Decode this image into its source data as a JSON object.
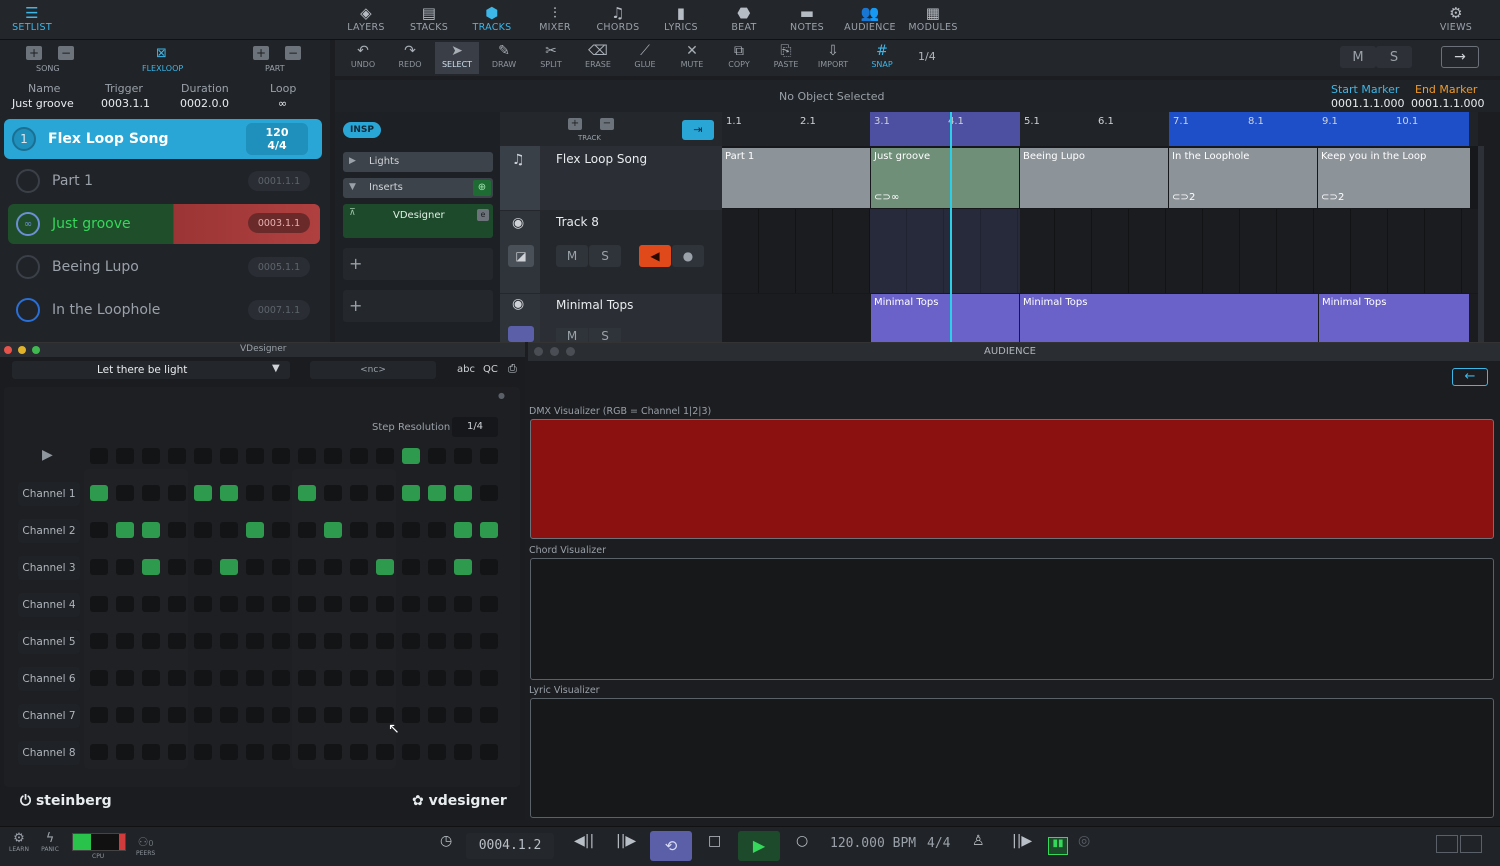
{
  "topnav": {
    "setlist": "SETLIST",
    "items": [
      "LAYERS",
      "STACKS",
      "TRACKS",
      "MIXER",
      "CHORDS",
      "LYRICS",
      "BEAT",
      "NOTES",
      "AUDIENCE",
      "MODULES"
    ],
    "views": "VIEWS"
  },
  "tools": {
    "items": [
      "UNDO",
      "REDO",
      "SELECT",
      "DRAW",
      "SPLIT",
      "ERASE",
      "GLUE",
      "MUTE",
      "COPY",
      "PASTE",
      "IMPORT",
      "SNAP"
    ],
    "grid": "1/4",
    "m": "M",
    "s": "S"
  },
  "setlist": {
    "song_label": "SONG",
    "flexloop_label": "FLEXLOOP",
    "part_label": "PART",
    "info": {
      "name_label": "Name",
      "name": "Just groove",
      "trigger_label": "Trigger",
      "trigger": "0003.1.1",
      "duration_label": "Duration",
      "duration": "0002.0.0",
      "loop_label": "Loop",
      "loop": "∞"
    },
    "song": {
      "num": "1",
      "name": "Flex Loop Song",
      "tempo": "120",
      "sig": "4/4"
    },
    "parts": [
      {
        "name": "Part 1",
        "pos": "0001.1.1"
      },
      {
        "name": "Just groove",
        "pos": "0003.1.1"
      },
      {
        "name": "Beeing Lupo",
        "pos": "0005.1.1"
      },
      {
        "name": "In the Loophole",
        "pos": "0007.1.1"
      }
    ]
  },
  "status": {
    "no_selection": "No Object Selected",
    "start_label": "Start Marker",
    "start": "0001.1.1.000",
    "end_label": "End Marker",
    "end": "0001.1.1.000"
  },
  "inspector": {
    "insp": "INSP",
    "lights": "Lights",
    "inserts": "Inserts",
    "plugin": "VDesigner",
    "track_label": "TRACK"
  },
  "tracks": [
    {
      "name": "Flex Loop Song"
    },
    {
      "name": "Track 8",
      "m": "M",
      "s": "S"
    },
    {
      "name": "Minimal Tops",
      "m": "M",
      "s": "S"
    }
  ],
  "ruler": [
    "1.1",
    "2.1",
    "3.1",
    "4.1",
    "5.1",
    "6.1",
    "7.1",
    "8.1",
    "9.1",
    "10.1"
  ],
  "parts_lane": {
    "part1": "Part  1",
    "groove": "Just groove",
    "groove_loop": "∞",
    "lupo": "Beeing Lupo",
    "loophole": "In the Loophole",
    "loophole_count": "2",
    "keep": "Keep you in the Loop",
    "keep_count": "2"
  },
  "minimal": {
    "clip": "Minimal Tops"
  },
  "vdesigner": {
    "title": "VDesigner",
    "preset": "Let there be light",
    "nc": "<nc>",
    "abc": "abc",
    "qc": "QC",
    "step_res_label": "Step Resolution",
    "step_res": "1/4",
    "channels": [
      "Channel 1",
      "Channel 2",
      "Channel 3",
      "Channel 4",
      "Channel 5",
      "Channel 6",
      "Channel 7",
      "Channel 8"
    ],
    "brand_left": "steinberg",
    "brand_right": "vdesigner"
  },
  "audience": {
    "title": "AUDIENCE",
    "dmx": "DMX Visualizer (RGB = Channel 1|2|3)",
    "dmx_color": "#8b1010",
    "chord": "Chord Visualizer",
    "lyric": "Lyric Visualizer"
  },
  "transport": {
    "learn": "LEARN",
    "panic": "PANIC",
    "cpu": "CPU",
    "peers": "PEERS",
    "peers_count": "0",
    "position": "0004.1.2",
    "bpm": "120.000 BPM",
    "sig": "4/4"
  }
}
